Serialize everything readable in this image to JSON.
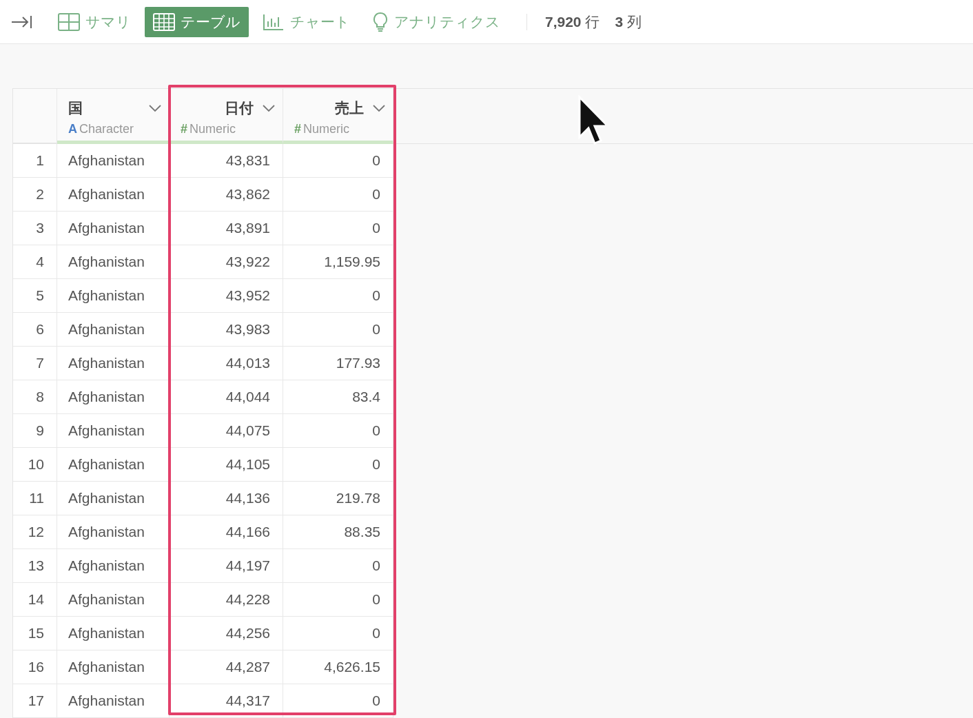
{
  "toolbar": {
    "tabs": [
      {
        "label": "サマリ",
        "kind": "summary",
        "selected": false
      },
      {
        "label": "テーブル",
        "kind": "table",
        "selected": true
      },
      {
        "label": "チャート",
        "kind": "chart",
        "selected": false
      },
      {
        "label": "アナリティクス",
        "kind": "analytics",
        "selected": false
      }
    ],
    "row_count": "**7,920** 行",
    "column_count": "**3** 列"
  },
  "table": {
    "columns": [
      {
        "name": "国",
        "type_symbol": "A",
        "type": "Character",
        "kind": "character",
        "highlighted": false
      },
      {
        "name": "日付",
        "type_symbol": "#",
        "type": "Numeric",
        "kind": "numeric",
        "highlighted": true
      },
      {
        "name": "売上",
        "type_symbol": "#",
        "type": "Numeric",
        "kind": "numeric",
        "highlighted": true
      }
    ],
    "rows": [
      {
        "number": "1",
        "cells": [
          "Afghanistan",
          "43,831",
          "0"
        ]
      },
      {
        "number": "2",
        "cells": [
          "Afghanistan",
          "43,862",
          "0"
        ]
      },
      {
        "number": "3",
        "cells": [
          "Afghanistan",
          "43,891",
          "0"
        ]
      },
      {
        "number": "4",
        "cells": [
          "Afghanistan",
          "43,922",
          "1,159.95"
        ]
      },
      {
        "number": "5",
        "cells": [
          "Afghanistan",
          "43,952",
          "0"
        ]
      },
      {
        "number": "6",
        "cells": [
          "Afghanistan",
          "43,983",
          "0"
        ]
      },
      {
        "number": "7",
        "cells": [
          "Afghanistan",
          "44,013",
          "177.93"
        ]
      },
      {
        "number": "8",
        "cells": [
          "Afghanistan",
          "44,044",
          "83.4"
        ]
      },
      {
        "number": "9",
        "cells": [
          "Afghanistan",
          "44,075",
          "0"
        ]
      },
      {
        "number": "10",
        "cells": [
          "Afghanistan",
          "44,105",
          "0"
        ]
      },
      {
        "number": "11",
        "cells": [
          "Afghanistan",
          "44,136",
          "219.78"
        ]
      },
      {
        "number": "12",
        "cells": [
          "Afghanistan",
          "44,166",
          "88.35"
        ]
      },
      {
        "number": "13",
        "cells": [
          "Afghanistan",
          "44,197",
          "0"
        ]
      },
      {
        "number": "14",
        "cells": [
          "Afghanistan",
          "44,228",
          "0"
        ]
      },
      {
        "number": "15",
        "cells": [
          "Afghanistan",
          "44,256",
          "0"
        ]
      },
      {
        "number": "16",
        "cells": [
          "Afghanistan",
          "44,287",
          "4,626.15"
        ]
      },
      {
        "number": "17",
        "cells": [
          "Afghanistan",
          "44,317",
          "0"
        ]
      }
    ]
  }
}
